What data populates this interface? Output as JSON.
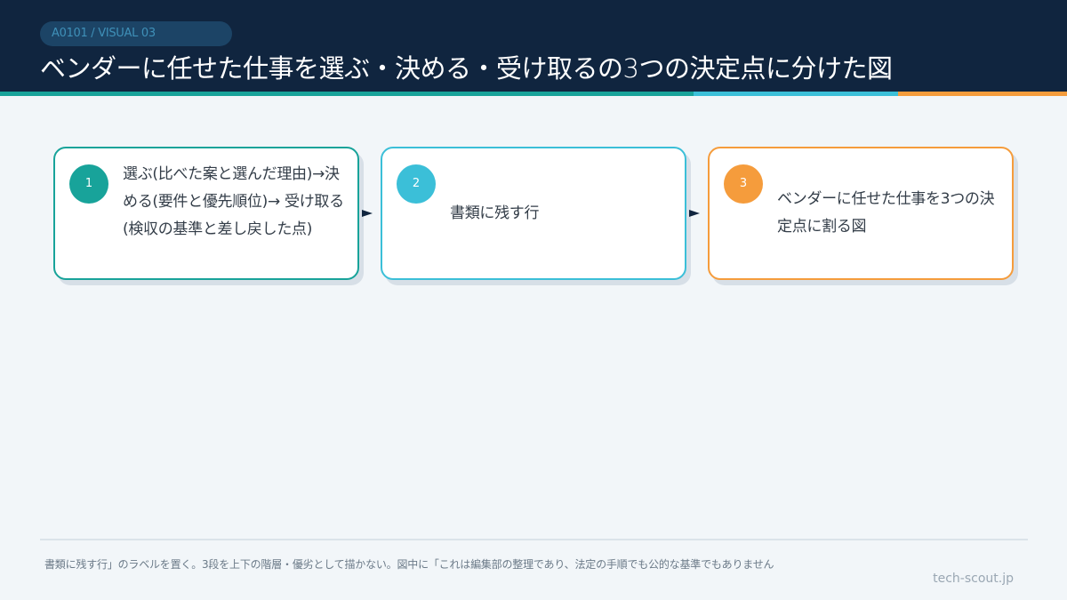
{
  "header": {
    "badge": "A0101 / VISUAL 03",
    "title": "ベンダーに任せた仕事を選ぶ・決める・受け取るの3つの決定点に分けた図"
  },
  "colors": {
    "header_bg": "#10253f",
    "step1": "#18a39a",
    "step2": "#3bbfd8",
    "step3": "#f59c3c",
    "background": "#f2f6f9"
  },
  "steps": [
    {
      "number": "1",
      "text": "選ぶ(比べた案と選んだ理由)→決める(要件と優先順位)→ 受け取る(検収の基準と差し戻した点)"
    },
    {
      "number": "2",
      "text": "書類に残す行"
    },
    {
      "number": "3",
      "text": "ベンダーに任せた仕事を3つの決定点に割る図"
    }
  ],
  "footer": {
    "note": "書類に残す行」のラベルを置く。3段を上下の階層・優劣として描かない。図中に「これは編集部の整理であり、法定の手順でも公的な基準でもありません",
    "site": "tech-scout.jp"
  }
}
